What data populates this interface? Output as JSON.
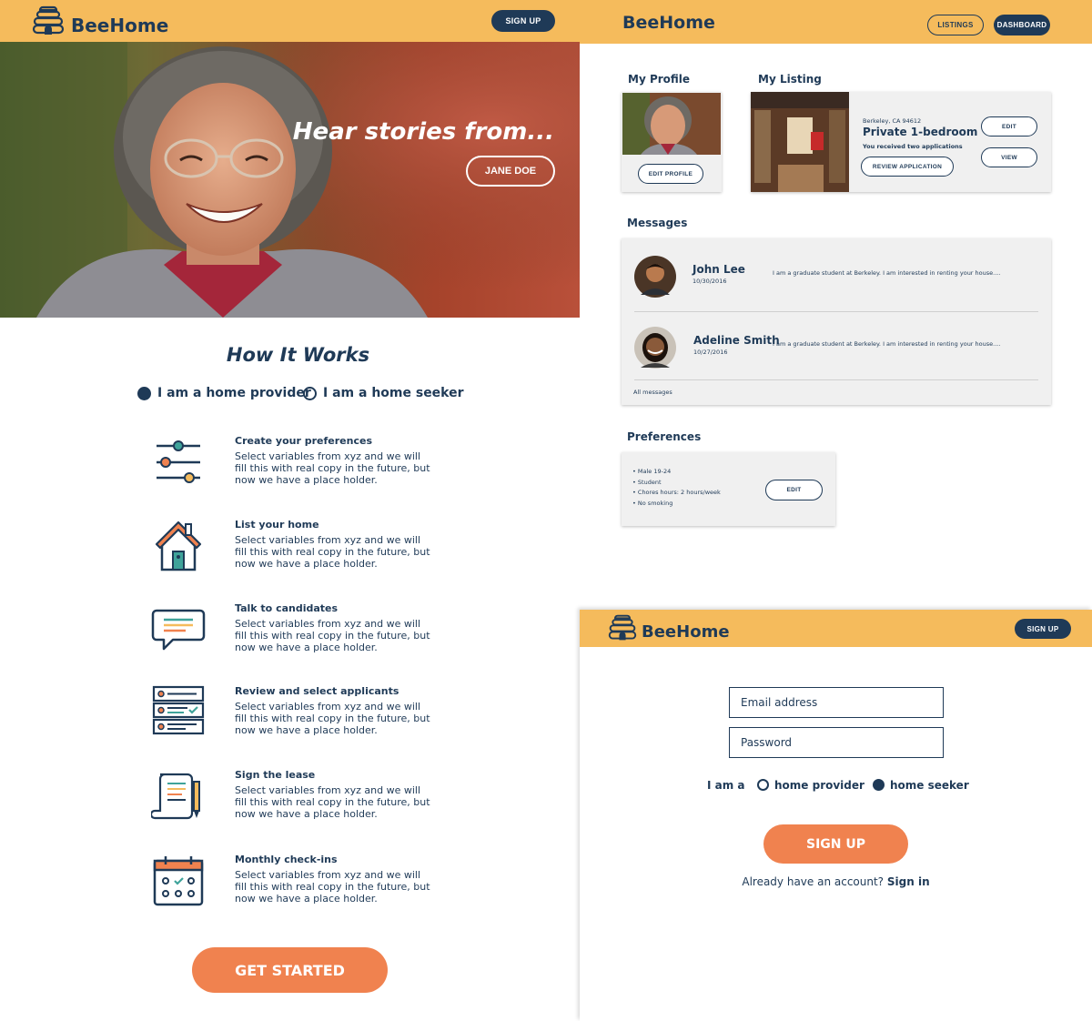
{
  "colors": {
    "brand_yellow": "#f5bb5c",
    "navy": "#1f3a57",
    "accent_orange": "#f0824f",
    "card_gray": "#f0f0f0"
  },
  "landing": {
    "brand": "BeeHome",
    "signup_label": "SIGN UP",
    "hero_headline": "Hear stories from...",
    "hero_button": "JANE DOE",
    "how_title": "How It Works",
    "radio_provider": "I am a home provider",
    "radio_seeker": "I am a home seeker",
    "steps": [
      {
        "icon": "sliders-icon",
        "title": "Create your preferences",
        "desc": "Select variables from xyz and we will fill this with real copy in the future, but now we have a place holder."
      },
      {
        "icon": "house-icon",
        "title": "List your home",
        "desc": "Select variables from xyz and we will fill this with real copy in the future, but now we have a place holder."
      },
      {
        "icon": "chat-bubble-icon",
        "title": "Talk to candidates",
        "desc": "Select variables from xyz and we will fill this with real copy in the future, but now we have a place holder."
      },
      {
        "icon": "checklist-icon",
        "title": "Review and select applicants",
        "desc": "Select variables from xyz and we will fill this with real copy in the future, but now we have a place holder."
      },
      {
        "icon": "scroll-pen-icon",
        "title": "Sign the lease",
        "desc": "Select variables from xyz and we will fill this with real copy in the future, but now we have a place holder."
      },
      {
        "icon": "calendar-icon",
        "title": "Monthly check-ins",
        "desc": "Select variables from xyz and we will fill this with real copy in the future, but now we have a place holder."
      }
    ],
    "get_started": "GET STARTED"
  },
  "dashboard": {
    "brand": "BeeHome",
    "nav_listings": "LISTINGS",
    "nav_dashboard": "DASHBOARD",
    "profile_heading": "My Profile",
    "edit_profile": "EDIT PROFILE",
    "listing_heading": "My Listing",
    "listing_location": "Berkeley, CA 94612",
    "listing_title": "Private 1-bedroom",
    "listing_apps": "You received two applications",
    "review_application": "REVIEW APPLICATION",
    "listing_edit": "EDIT",
    "listing_view": "VIEW",
    "messages_heading": "Messages",
    "messages": [
      {
        "name": "John Lee",
        "date": "10/30/2016",
        "preview": "I am a graduate student at Berkeley. I am interested in renting your house...."
      },
      {
        "name": "Adeline Smith",
        "date": "10/27/2016",
        "preview": "I am a graduate student at Berkeley. I am interested in renting your house...."
      }
    ],
    "all_messages": "All messages",
    "preferences_heading": "Preferences",
    "preferences": [
      "• Male 19-24",
      "• Student",
      "• Chores hours: 2 hours/week",
      "• No smoking"
    ],
    "preferences_edit": "EDIT"
  },
  "signup": {
    "brand": "BeeHome",
    "signup_label": "SIGN UP",
    "email_placeholder": "Email address",
    "password_placeholder": "Password",
    "i_am": "I am a",
    "role_provider": "home provider",
    "role_seeker": "home seeker",
    "submit": "SIGN UP",
    "already": "Already have an account?",
    "sign_in": "Sign in"
  }
}
